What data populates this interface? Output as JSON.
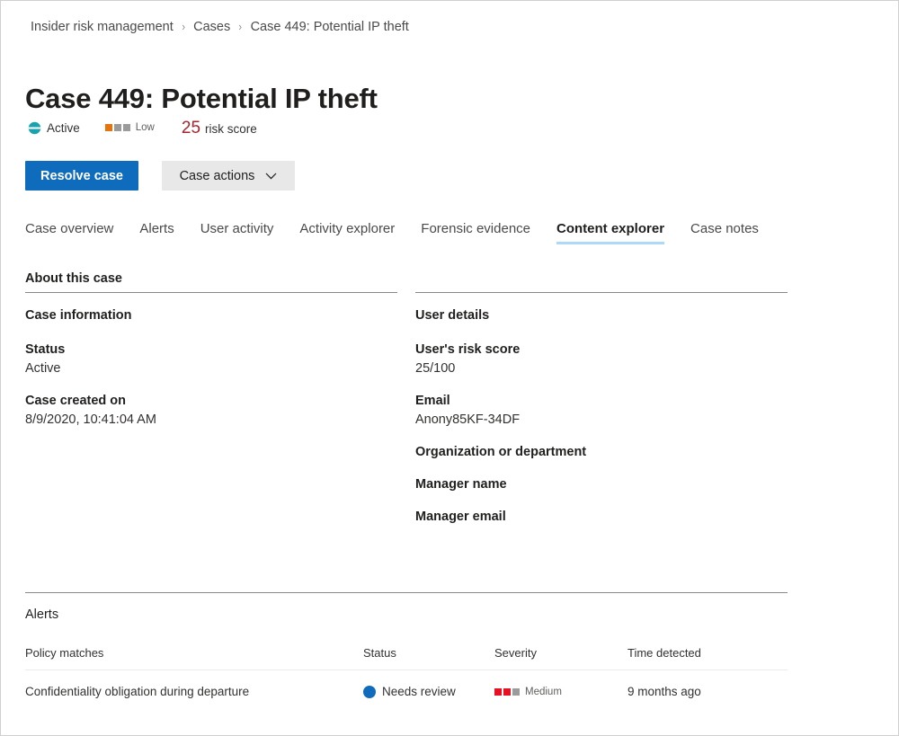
{
  "breadcrumb": {
    "items": [
      {
        "label": "Insider risk management"
      },
      {
        "label": "Cases"
      },
      {
        "label": "Case 449: Potential IP theft"
      }
    ],
    "separator": "›"
  },
  "header": {
    "title": "Case 449: Potential IP theft",
    "status": {
      "icon": "active-status-icon",
      "label": "Active",
      "color": "#17a2b0"
    },
    "severity": {
      "icon": "severity-blocks-icon",
      "label": "Low",
      "filled": 1,
      "total": 3,
      "fill_color": "#e8730a",
      "empty_color": "#9b9b9b"
    },
    "risk": {
      "score": "25",
      "label": "risk score",
      "color": "#a4262c"
    }
  },
  "toolbar": {
    "resolve_label": "Resolve case",
    "actions_label": "Case actions",
    "chevron_icon": "chevron-down-icon",
    "primary_color": "#0f6cbd",
    "secondary_color": "#e8e8e8"
  },
  "tabs": {
    "active_index": 5,
    "active_underline_color": "#aed8f7",
    "items": [
      {
        "label": "Case overview"
      },
      {
        "label": "Alerts"
      },
      {
        "label": "User activity"
      },
      {
        "label": "Activity explorer"
      },
      {
        "label": "Forensic evidence"
      },
      {
        "label": "Content explorer"
      },
      {
        "label": "Case notes"
      }
    ]
  },
  "about": {
    "heading": "About this case",
    "case_information": {
      "title": "Case information",
      "fields": [
        {
          "label": "Status",
          "value": "Active"
        },
        {
          "label": "Case created on",
          "value": "8/9/2020, 10:41:04 AM"
        }
      ]
    },
    "user_details": {
      "title": "User details",
      "fields": [
        {
          "label": "User's risk score",
          "value": "25/100"
        },
        {
          "label": "Email",
          "value": "Anony85KF-34DF"
        },
        {
          "label": "Organization or department",
          "value": ""
        },
        {
          "label": "Manager name",
          "value": ""
        },
        {
          "label": "Manager email",
          "value": ""
        }
      ]
    }
  },
  "alerts": {
    "heading": "Alerts",
    "columns": [
      {
        "label": "Policy matches"
      },
      {
        "label": "Status"
      },
      {
        "label": "Severity"
      },
      {
        "label": "Time detected"
      }
    ],
    "rows": [
      {
        "policy": "Confidentiality obligation during departure",
        "status": "Needs review",
        "status_dot_color": "#0f6cbd",
        "severity": "Medium",
        "severity_filled": 2,
        "severity_total": 3,
        "severity_fill_color": "#e81123",
        "severity_empty_color": "#9b9b9b",
        "time_detected": "9 months ago"
      }
    ]
  }
}
